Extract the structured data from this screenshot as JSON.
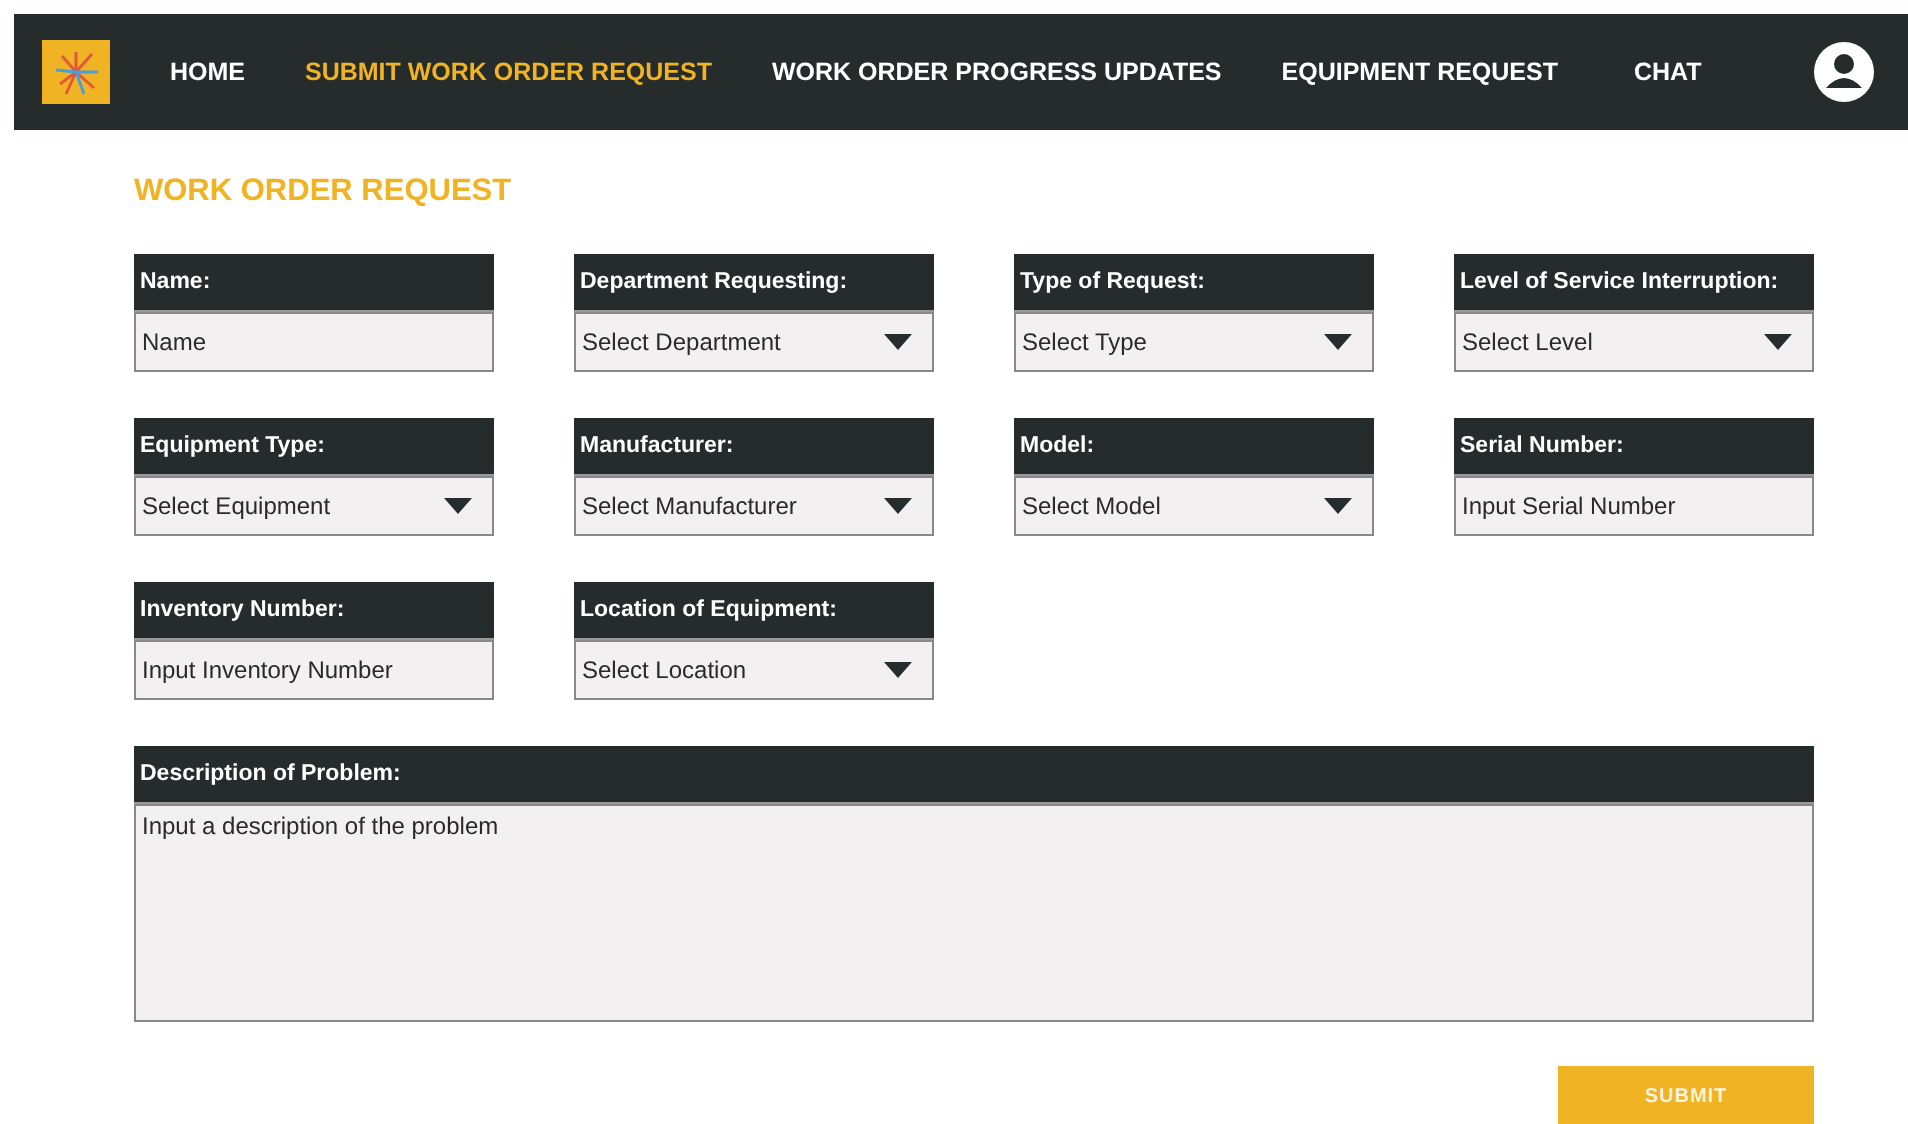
{
  "nav": {
    "items": [
      {
        "label": "HOME",
        "selected": false
      },
      {
        "label": "SUBMIT WORK ORDER REQUEST",
        "selected": true
      },
      {
        "label": "WORK ORDER PROGRESS UPDATES",
        "selected": false
      },
      {
        "label": "EQUIPMENT REQUEST",
        "selected": false
      },
      {
        "label": "CHAT",
        "selected": false
      }
    ]
  },
  "page_title": "WORK ORDER REQUEST",
  "fields": [
    {
      "label": "Name:",
      "kind": "text",
      "placeholder": "Name"
    },
    {
      "label": "Department Requesting:",
      "kind": "select",
      "value": "Select Department"
    },
    {
      "label": "Type of Request:",
      "kind": "select",
      "value": "Select Type"
    },
    {
      "label": "Level of Service Interruption:",
      "kind": "select",
      "value": "Select Level"
    },
    {
      "label": "Equipment Type:",
      "kind": "select",
      "value": "Select Equipment"
    },
    {
      "label": "Manufacturer:",
      "kind": "select",
      "value": "Select Manufacturer"
    },
    {
      "label": "Model:",
      "kind": "select",
      "value": "Select Model"
    },
    {
      "label": "Serial Number:",
      "kind": "text",
      "placeholder": "Input Serial Number"
    },
    {
      "label": "Inventory Number:",
      "kind": "text",
      "placeholder": "Input Inventory Number"
    },
    {
      "label": "Location of Equipment:",
      "kind": "select",
      "value": "Select Location"
    }
  ],
  "description": {
    "label": "Description of Problem:",
    "placeholder": "Input a description of the problem"
  },
  "submit_button": "SUBMIT"
}
